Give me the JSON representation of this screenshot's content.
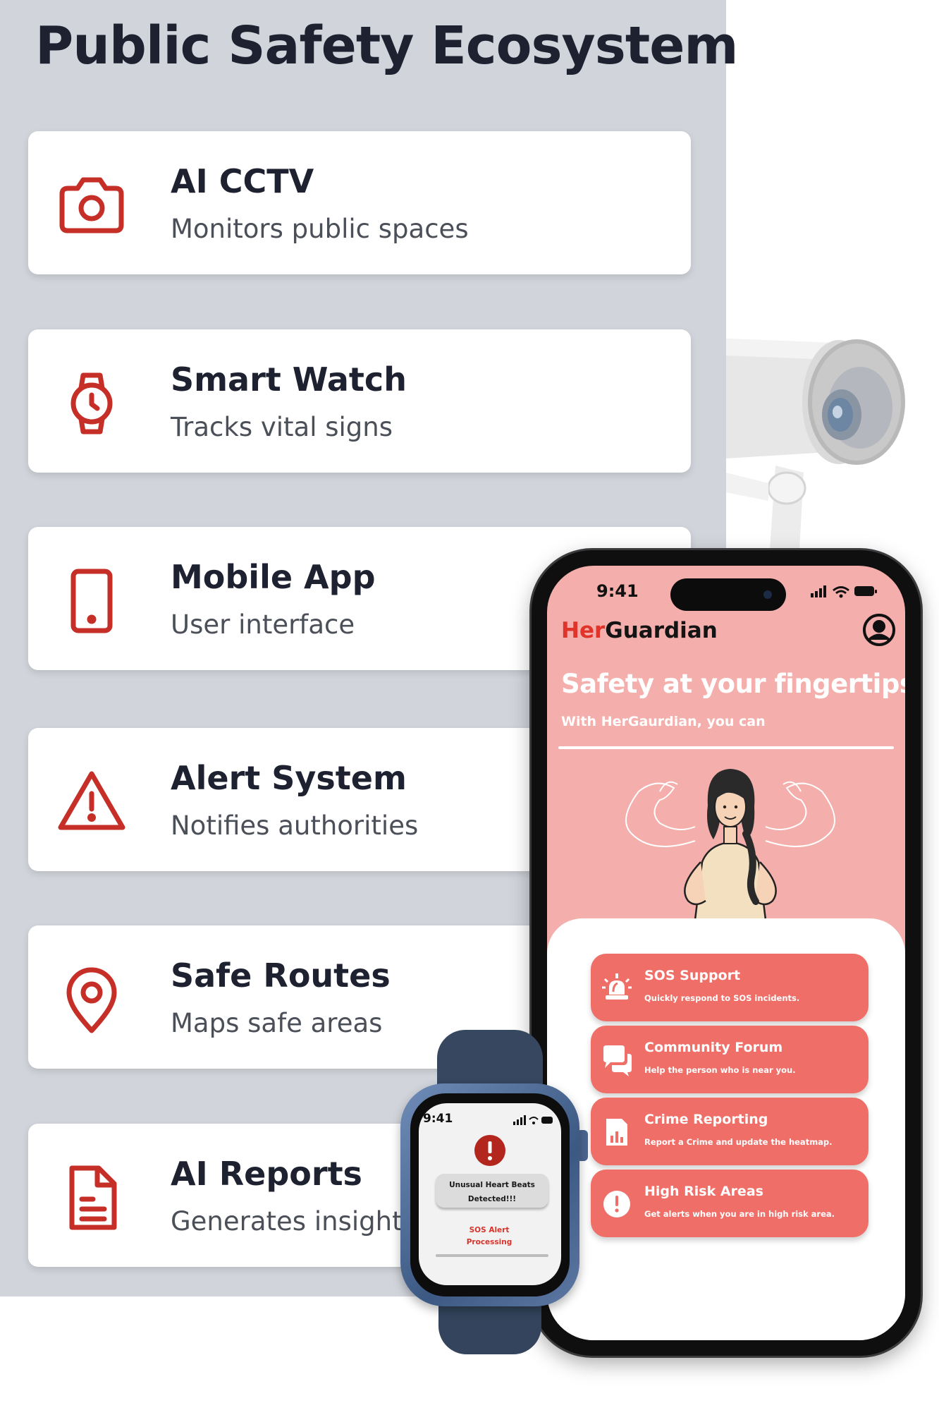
{
  "page": {
    "title": "Public Safety Ecosystem"
  },
  "cards": [
    {
      "title": "AI CCTV",
      "desc": "Monitors public spaces",
      "icon": "camera-icon"
    },
    {
      "title": "Smart Watch",
      "desc": "Tracks vital signs",
      "icon": "watch-icon"
    },
    {
      "title": "Mobile App",
      "desc": "User interface",
      "icon": "tablet-icon"
    },
    {
      "title": "Alert System",
      "desc": "Notifies authorities",
      "icon": "warning-icon"
    },
    {
      "title": "Safe Routes",
      "desc": "Maps safe areas",
      "icon": "map-pin-icon"
    },
    {
      "title": "AI Reports",
      "desc": "Generates insights",
      "icon": "document-icon"
    }
  ],
  "phone": {
    "time": "9:41",
    "brand_part1": "Her",
    "brand_part2": "Guardian",
    "hero_title": "Safety at your fingertips",
    "hero_subtitle": "With HerGaurdian, you can",
    "features": [
      {
        "title": "SOS Support",
        "desc": "Quickly respond to SOS incidents.",
        "icon": "siren-icon"
      },
      {
        "title": "Community Forum",
        "desc": "Help the person who is near you.",
        "icon": "chat-icon"
      },
      {
        "title": "Crime Reporting",
        "desc": "Report a Crime and update the heatmap.",
        "icon": "report-chart-icon"
      },
      {
        "title": "High Risk Areas",
        "desc": "Get alerts when you are in high risk area.",
        "icon": "alert-circle-icon"
      }
    ]
  },
  "watch": {
    "time": "9:41",
    "alert_text": "Unusual Heart Beats\nDetected!!!",
    "sos_text": "SOS Alert\nProcessing"
  },
  "colors": {
    "panel_bg": "#d1d5db",
    "icon_red": "#c62f27",
    "phone_bg": "#f4aeab",
    "feature_bg": "#ef6f68",
    "brand_red": "#e0342a"
  }
}
